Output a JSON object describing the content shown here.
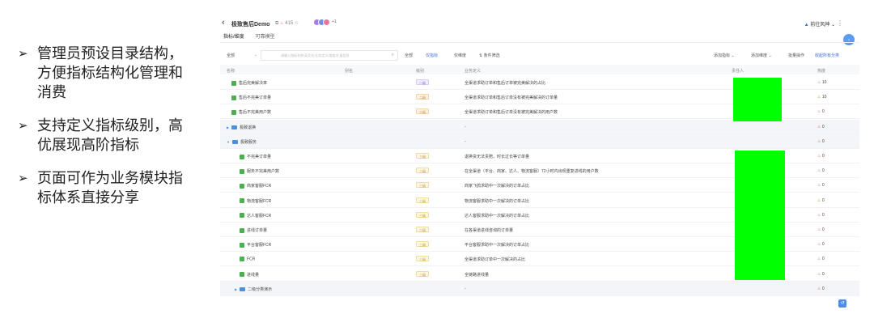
{
  "bullets": [
    {
      "text": "管理员预设目录结构，方便指标结构化管理和消费"
    },
    {
      "text": "支持定义指标级别，高优展现高阶指标"
    },
    {
      "text": "页面可作为业务模块指标体系直接分享"
    }
  ],
  "app": {
    "back_icon": "chevron-left-icon",
    "title": "极致售后Demo",
    "view_count": "415",
    "avatar_more": "+1",
    "user": "前往风神",
    "tabs": [
      {
        "label": "指标/维度"
      },
      {
        "label": "可靠模型"
      }
    ]
  },
  "toolbar": {
    "scope": "全部",
    "search_placeholder": "请输入指标名称/英文名/业务定义/维度/扩展信息",
    "filters": [
      {
        "label": "全部"
      },
      {
        "label": "仅指标"
      },
      {
        "label": "仅维度"
      },
      {
        "label": "条件筛选"
      }
    ],
    "actions": [
      {
        "label": "添加指标"
      },
      {
        "label": "添加维度"
      },
      {
        "label": "批量操作"
      },
      {
        "label": "收起所有分类"
      }
    ]
  },
  "table": {
    "headers": {
      "name": "名称",
      "alias": "别名",
      "level": "级别",
      "definition": "业务定义",
      "owner": "责任人",
      "heat": "热度"
    },
    "rows": [
      {
        "type": "indicator",
        "indent": 0,
        "name": "售后完美解决率",
        "level": "一级",
        "level_class": "l1",
        "definition": "全渠道求助订单和售后订单被完美解决的占比",
        "heat": "10"
      },
      {
        "type": "indicator",
        "indent": 0,
        "name": "售后不完美订单量",
        "level": "二级",
        "level_class": "l2",
        "definition": "全渠道求助订单和售后订单没有被完美解决的订单量",
        "heat": "10"
      },
      {
        "type": "indicator",
        "indent": 0,
        "name": "售后不完美用户数",
        "level": "二级",
        "level_class": "l2",
        "definition": "全渠道求助订单和售后订单没有被完美解决的用户数",
        "heat": "0"
      },
      {
        "type": "folder",
        "indent": 0,
        "expanded": false,
        "name": "极致退换",
        "level": "",
        "definition": "-",
        "heat": "0"
      },
      {
        "type": "folder",
        "indent": 0,
        "expanded": true,
        "name": "极致服务",
        "level": "",
        "definition": "-",
        "heat": "0"
      },
      {
        "type": "indicator",
        "indent": 1,
        "name": "不完美订单量",
        "level": "三级",
        "level_class": "l3",
        "definition": "退换货无法责赔，时长过长等订单量",
        "heat": "0"
      },
      {
        "type": "indicator",
        "indent": 1,
        "name": "服务不完美用户数",
        "level": "三级",
        "level_class": "l3",
        "definition": "在全渠道（平台、商家、达人、物流客服）72小时内出现重复进线的用户数",
        "heat": "0"
      },
      {
        "type": "indicator",
        "indent": 1,
        "name": "商家客服FCR",
        "level": "三级",
        "level_class": "l3",
        "definition": "商家飞鸽求助中一次解决的订单占比",
        "heat": "0"
      },
      {
        "type": "indicator",
        "indent": 1,
        "name": "物流客服FCR",
        "level": "三级",
        "level_class": "l3",
        "definition": "物流客服求助中一次解决的订单占比",
        "heat": "0"
      },
      {
        "type": "indicator",
        "indent": 1,
        "name": "达人客服FCR",
        "level": "三级",
        "level_class": "l3",
        "definition": "达人客服求助中一次解决的订单占比",
        "heat": "0"
      },
      {
        "type": "indicator",
        "indent": 1,
        "name": "进线订单量",
        "level": "三级",
        "level_class": "l3",
        "definition": "在各渠道进线咨询的订单量",
        "heat": "0"
      },
      {
        "type": "indicator",
        "indent": 1,
        "name": "平台客服FCR",
        "level": "三级",
        "level_class": "l3",
        "definition": "平台客服求助中一次解决的订单占比",
        "heat": "0"
      },
      {
        "type": "indicator",
        "indent": 1,
        "name": "FCR",
        "level": "三级",
        "level_class": "l3",
        "definition": "全渠道求助订单中一次解决的占比",
        "heat": "0"
      },
      {
        "type": "indicator",
        "indent": 1,
        "name": "进线量",
        "level": "三级",
        "level_class": "l3",
        "definition": "全链路进线量",
        "heat": "0"
      },
      {
        "type": "folder",
        "indent": 1,
        "expanded": false,
        "name": "二级分类演示",
        "level": "",
        "definition": "-",
        "heat": "0"
      }
    ]
  },
  "colors": {
    "redaction": "#00ff00",
    "accent": "#3b6fd6",
    "indicator_icon": "#4caf50",
    "folder_icon": "#4c8fe0"
  }
}
